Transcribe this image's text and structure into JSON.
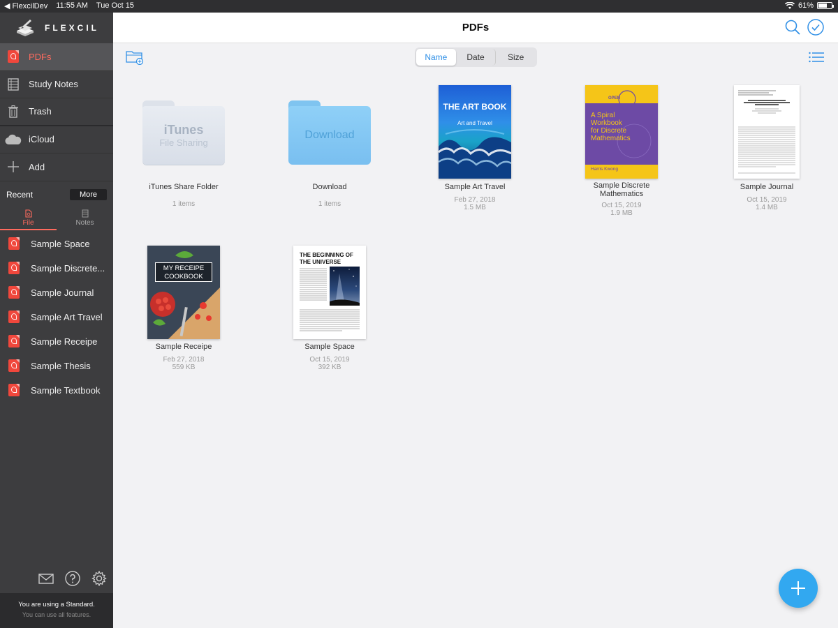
{
  "status_bar": {
    "carrier": "◀ FlexcilDev",
    "time": "11:55 AM",
    "date": "Tue Oct 15",
    "battery": "61%",
    "battery_level": 0.61
  },
  "sidebar": {
    "logo": "FLEXCIL",
    "nav": [
      {
        "label": "PDFs",
        "icon": "pdf-icon"
      },
      {
        "label": "Study Notes",
        "icon": "notebook-icon"
      },
      {
        "label": "Trash",
        "icon": "trash-icon"
      },
      {
        "label": "iCloud",
        "icon": "cloud-icon"
      },
      {
        "label": "Add",
        "icon": "plus-icon"
      }
    ],
    "recent_label": "Recent",
    "more_label": "More",
    "tabs": [
      {
        "label": "File"
      },
      {
        "label": "Notes"
      }
    ],
    "recent_items": [
      "Sample Space",
      "Sample Discrete...",
      "Sample Journal",
      "Sample Art Travel",
      "Sample Receipe",
      "Sample Thesis",
      "Sample Textbook"
    ],
    "plan_line1": "You are using a Standard.",
    "plan_line2": "You can use all features."
  },
  "header": {
    "title": "PDFs"
  },
  "sort": {
    "options": [
      "Name",
      "Date",
      "Size"
    ],
    "selected": "Name"
  },
  "items": [
    {
      "name": "iTunes Share Folder",
      "meta1": "1 items",
      "folder_label1": "iTunes",
      "folder_label2": "File Sharing"
    },
    {
      "name": "Download",
      "meta1": "1 items",
      "folder_label1": "Download"
    },
    {
      "name": "Sample Art Travel",
      "meta1": "Feb 27, 2018",
      "meta2": "1.5 MB",
      "cover_title": "THE ART BOOK",
      "cover_sub": "Art and Travel"
    },
    {
      "name": "Sample Discrete Mathematics",
      "meta1": "Oct 15, 2019",
      "meta2": "1.9 MB",
      "cover_badge": "OPEN",
      "cover_title1": "A Spiral",
      "cover_title2": "Workbook",
      "cover_title3": "for Discrete",
      "cover_title4": "Mathematics",
      "cover_author": "Harris Kwong"
    },
    {
      "name": "Sample Journal",
      "meta1": "Oct 15, 2019",
      "meta2": "1.4 MB"
    },
    {
      "name": "Sample Receipe",
      "meta1": "Feb 27, 2018",
      "meta2": "559 KB",
      "cover_title1": "MY RECEIPE",
      "cover_title2": "COOKBOOK"
    },
    {
      "name": "Sample Space",
      "meta1": "Oct 15, 2019",
      "meta2": "392 KB",
      "cover_title1": "THE BEGINNING OF",
      "cover_title2": "THE UNIVERSE"
    }
  ]
}
